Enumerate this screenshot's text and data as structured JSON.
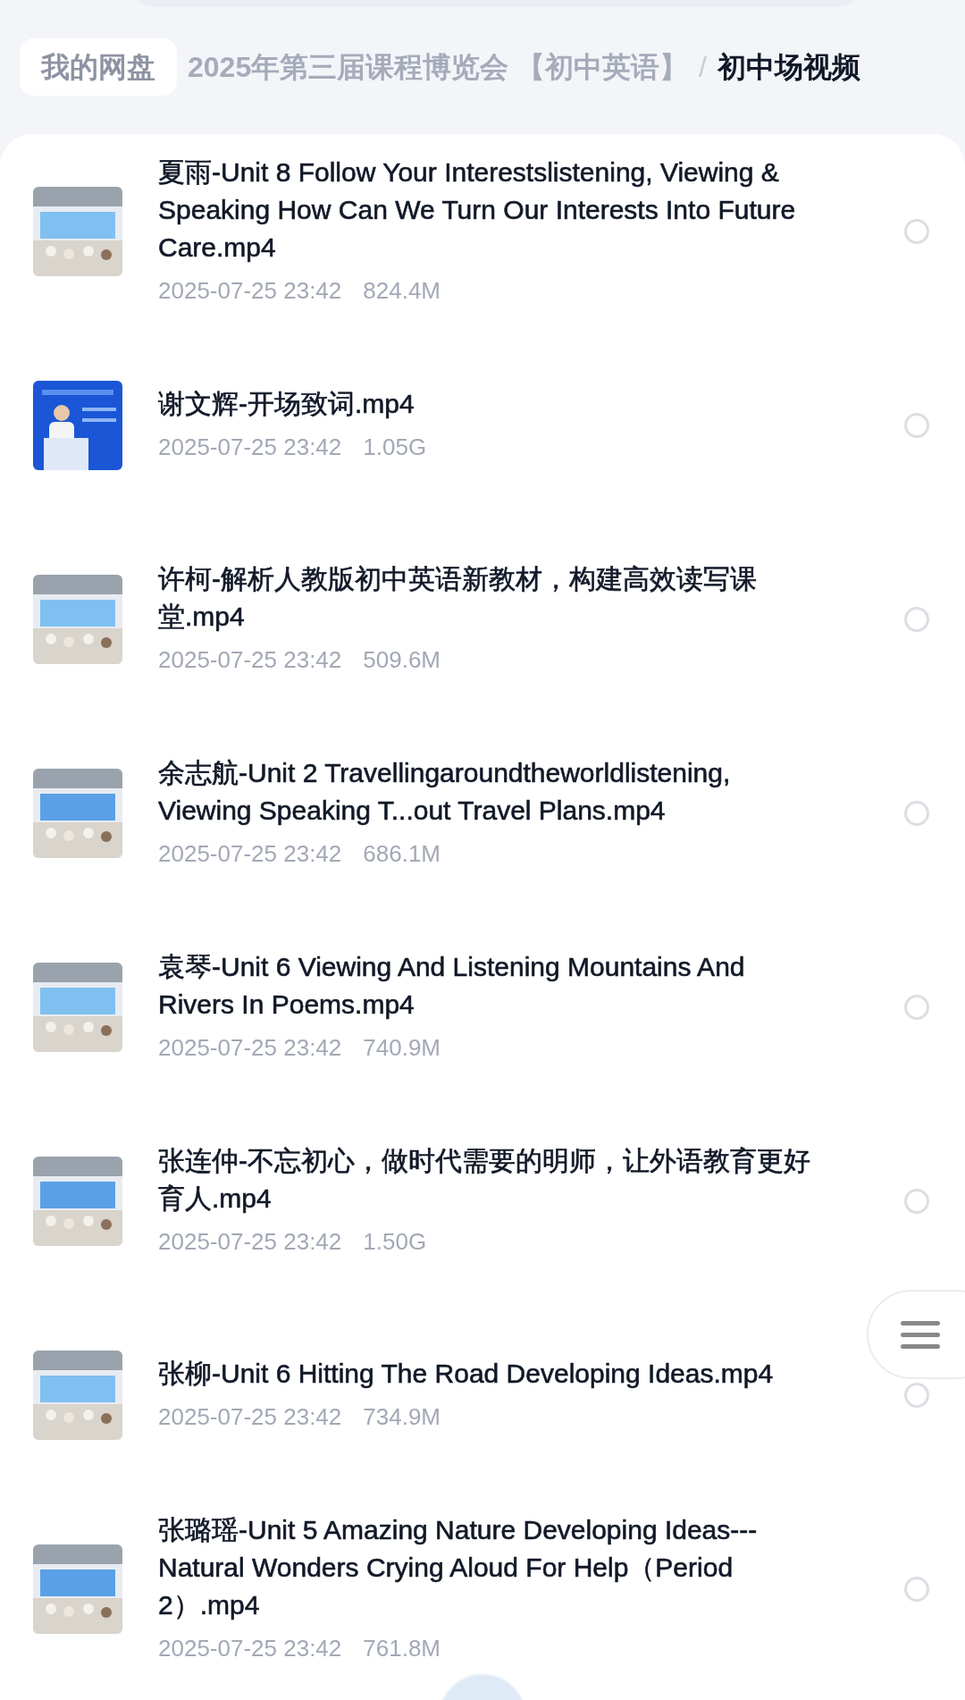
{
  "breadcrumb": {
    "root": "我的网盘",
    "folder": "2025年第三届课程博览会 【初中英语】",
    "separator": "/",
    "current": "初中场视频"
  },
  "files": [
    {
      "name": "夏雨-Unit 8 Follow Your Interestslistening, Viewing & Speaking How Can We Turn Our Interests Into Future Care.mp4",
      "date": "2025-07-25 23:42",
      "size": "824.4M",
      "selected": false
    },
    {
      "name": "谢文辉-开场致词.mp4",
      "date": "2025-07-25 23:42",
      "size": "1.05G",
      "selected": false
    },
    {
      "name": "许柯-解析人教版初中英语新教材，构建高效读写课堂.mp4",
      "date": "2025-07-25 23:42",
      "size": "509.6M",
      "selected": false
    },
    {
      "name": "余志航-Unit 2 Travellingaroundtheworldlistening, Viewing  Speaking T...out Travel Plans.mp4",
      "date": "2025-07-25 23:42",
      "size": "686.1M",
      "selected": false
    },
    {
      "name": "袁琴-Unit 6 Viewing And Listening Mountains And Rivers In Poems.mp4",
      "date": "2025-07-25 23:42",
      "size": "740.9M",
      "selected": false
    },
    {
      "name": "张连仲-不忘初心，做时代需要的明师，让外语教育更好育人.mp4",
      "date": "2025-07-25 23:42",
      "size": "1.50G",
      "selected": false
    },
    {
      "name": "张柳-Unit 6 Hitting The Road Developing Ideas.mp4",
      "date": "2025-07-25 23:42",
      "size": "734.9M",
      "selected": false
    },
    {
      "name": "张璐瑶-Unit 5 Amazing Nature Developing Ideas---Natural Wonders Crying Aloud For Help（Period 2）.mp4",
      "date": "2025-07-25 23:42",
      "size": "761.8M",
      "selected": false
    }
  ]
}
